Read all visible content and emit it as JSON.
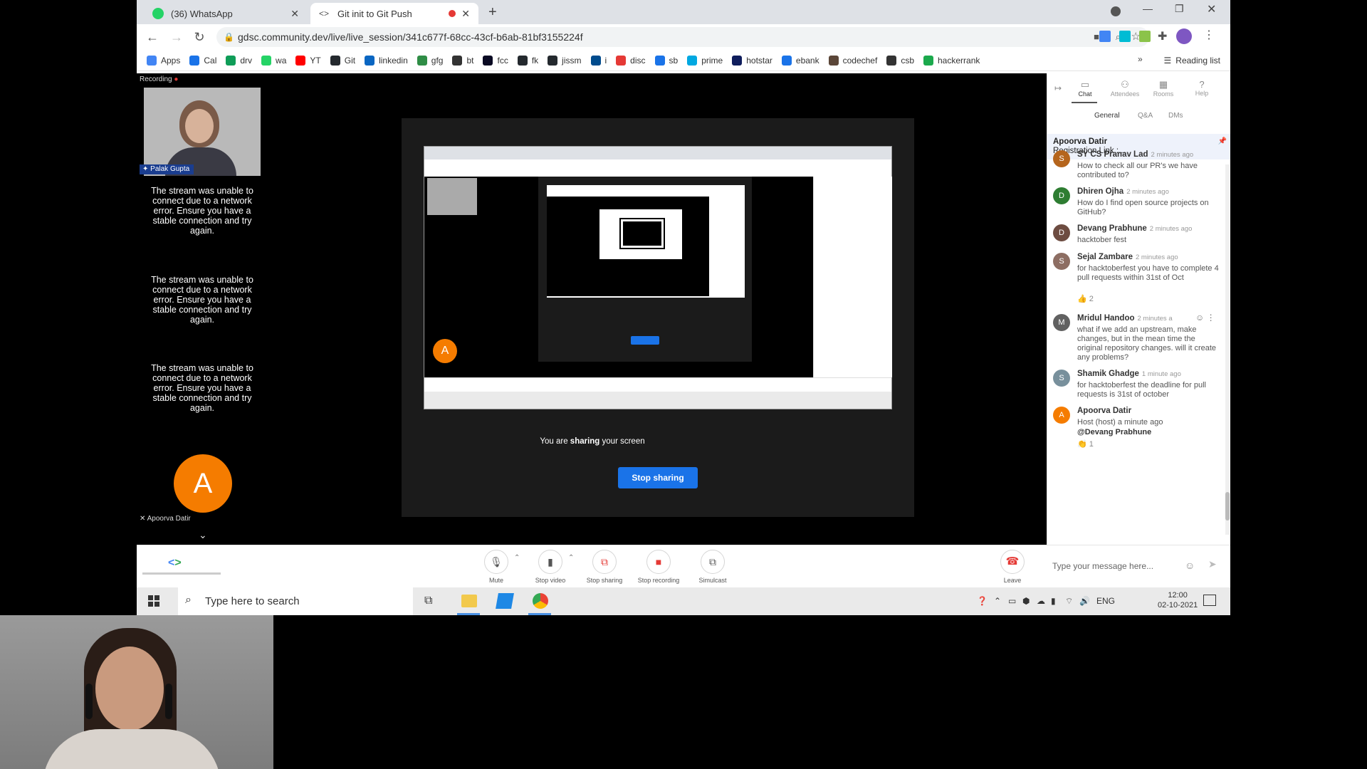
{
  "browser": {
    "tabs": [
      {
        "title": "(36) WhatsApp",
        "active": false,
        "favicon_color": "#25d366"
      },
      {
        "title": "Git init to Git Push",
        "active": true,
        "favicon_color": "#555555"
      }
    ],
    "new_tab": "+",
    "url": "gdsc.community.dev/live/live_session/341c677f-68cc-43cf-b6ab-81bf3155224f",
    "bookmarks": [
      {
        "label": "Apps",
        "color": "#4285f4"
      },
      {
        "label": "Cal",
        "color": "#1a73e8"
      },
      {
        "label": "drv",
        "color": "#0f9d58"
      },
      {
        "label": "wa",
        "color": "#25d366"
      },
      {
        "label": "YT",
        "color": "#ff0000"
      },
      {
        "label": "Git",
        "color": "#24292e"
      },
      {
        "label": "linkedin",
        "color": "#0a66c2"
      },
      {
        "label": "gfg",
        "color": "#2f8d46"
      },
      {
        "label": "bt",
        "color": "#333333"
      },
      {
        "label": "fcc",
        "color": "#0a0a23"
      },
      {
        "label": "fk",
        "color": "#24292e"
      },
      {
        "label": "jissm",
        "color": "#24292e"
      },
      {
        "label": "i",
        "color": "#004b8d"
      },
      {
        "label": "disc",
        "color": "#e53935"
      },
      {
        "label": "sb",
        "color": "#1a73e8"
      },
      {
        "label": "prime",
        "color": "#00a8e1"
      },
      {
        "label": "hotstar",
        "color": "#0f1d5c"
      },
      {
        "label": "ebank",
        "color": "#1a73e8"
      },
      {
        "label": "codechef",
        "color": "#5b4638"
      },
      {
        "label": "csb",
        "color": "#333333"
      },
      {
        "label": "hackerrank",
        "color": "#1ba94c"
      }
    ],
    "overflow": "»",
    "reading_list": "Reading list"
  },
  "meeting": {
    "recording": "Recording",
    "presenter_name": "Palak Gupta",
    "error_message": "The stream was unable to connect due to a network error. Ensure you have a stable connection and try again.",
    "attendee_initial": "A",
    "attendee_name": "Apoorva Datir",
    "share_text_prefix": "You are ",
    "share_text_bold": "sharing",
    "share_text_suffix": " your screen",
    "stop_sharing": "Stop sharing"
  },
  "chat": {
    "tabs": [
      "Chat",
      "Attendees",
      "Rooms",
      "Help"
    ],
    "subtabs": [
      "General",
      "Q&A",
      "DMs"
    ],
    "pinned_name": "Apoorva Datir",
    "pinned_text": "Registration Link :...",
    "messages": [
      {
        "initial": "S",
        "color": "#b5651d",
        "name": "SY CS Pranav Lad",
        "time": "2 minutes ago",
        "text": "How to check all our PR's we have contributed to?"
      },
      {
        "initial": "D",
        "color": "#2e7d32",
        "name": "Dhiren Ojha",
        "time": "2 minutes ago",
        "text": "How do I find open source projects on GitHub?"
      },
      {
        "initial": "D",
        "color": "#6d4c41",
        "name": "Devang Prabhune",
        "time": "2 minutes ago",
        "text": "hacktober fest"
      },
      {
        "initial": "S",
        "color": "#8d6e63",
        "name": "Sejal Zambare",
        "time": "2 minutes ago",
        "text": "for hacktoberfest you have to complete 4 pull requests within 31st of Oct",
        "reaction": "👍 2"
      },
      {
        "initial": "M",
        "color": "#616161",
        "name": "Mridul Handoo",
        "time": "2 minutes a",
        "text": "what if we add an upstream, make changes, but in the mean time the original repository changes. will it create any problems?"
      },
      {
        "initial": "S",
        "color": "#78909c",
        "name": "Shamik Ghadge",
        "time": "1 minute ago",
        "text": "for hacktoberfest the deadline for pull requests is 31st of october"
      },
      {
        "initial": "A",
        "color": "#f57c00",
        "name": "Apoorva Datir",
        "time": "",
        "text": "Host (host) a minute ago",
        "mention": "@Devang Prabhune",
        "reaction": "👏 1"
      }
    ],
    "input_placeholder": "Type your message here..."
  },
  "controls": [
    {
      "label": "Mute",
      "icon": "mic-icon",
      "glyph": "🎙"
    },
    {
      "label": "Stop video",
      "icon": "camera-icon",
      "glyph": "▮"
    },
    {
      "label": "Stop sharing",
      "icon": "screen-share-icon",
      "glyph": "⧉"
    },
    {
      "label": "Stop recording",
      "icon": "record-icon",
      "glyph": "■"
    },
    {
      "label": "Simulcast",
      "icon": "cast-icon",
      "glyph": "⧉"
    }
  ],
  "leave": "Leave",
  "taskbar": {
    "search": "Type here to search",
    "lang": "ENG",
    "time": "12:00",
    "date": "02-10-2021"
  },
  "colors": {
    "accent": "#1a73e8",
    "avatar_orange": "#f57c00",
    "leave_red": "#e53935"
  }
}
